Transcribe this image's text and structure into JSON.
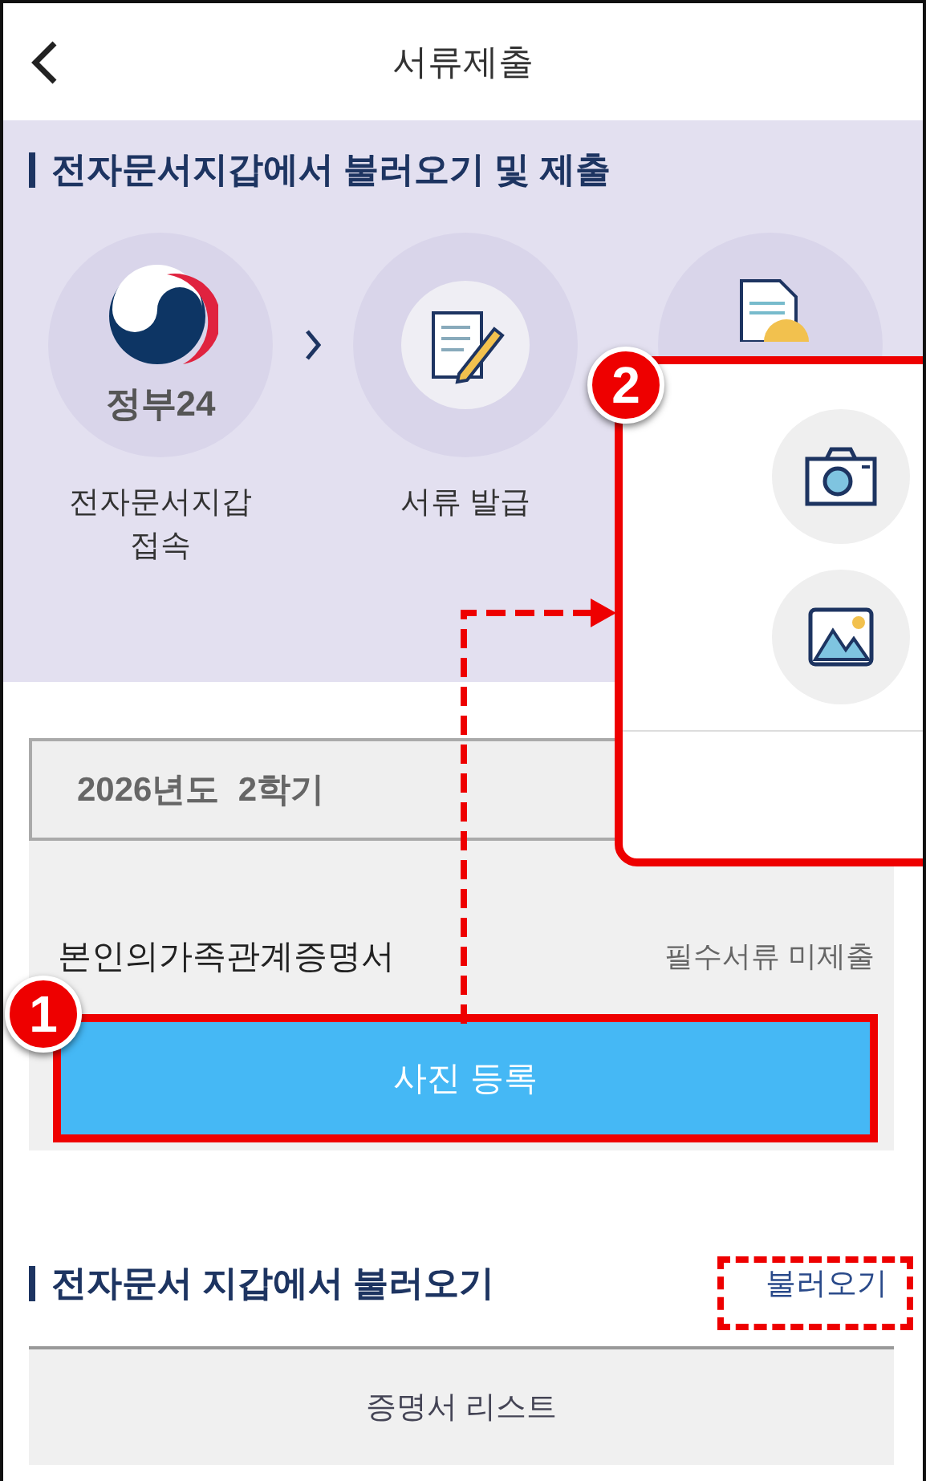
{
  "header": {
    "title": "서류제출"
  },
  "guide": {
    "heading": "전자문서지갑에서 불러오기 및 제출",
    "steps": [
      {
        "kind": "gov-logo",
        "logo_text": "정부24",
        "label": "전자문서지갑\n접속"
      },
      {
        "kind": "form",
        "label": "서류 발급"
      },
      {
        "kind": "document"
      }
    ]
  },
  "document_card": {
    "term_select": "2026년도  2학기",
    "document_name": "본인의가족관계증명서",
    "status": "필수서류 미제출",
    "upload_button": "사진 등록"
  },
  "wallet_section": {
    "heading": "전자문서 지갑에서 불러오기",
    "load_link": "불러오기",
    "list_header": "증명서 리스트"
  },
  "popup": {
    "options": [
      {
        "kind": "camera"
      },
      {
        "kind": "gallery"
      }
    ]
  },
  "annotations": [
    {
      "number": "1"
    },
    {
      "number": "2"
    }
  ]
}
